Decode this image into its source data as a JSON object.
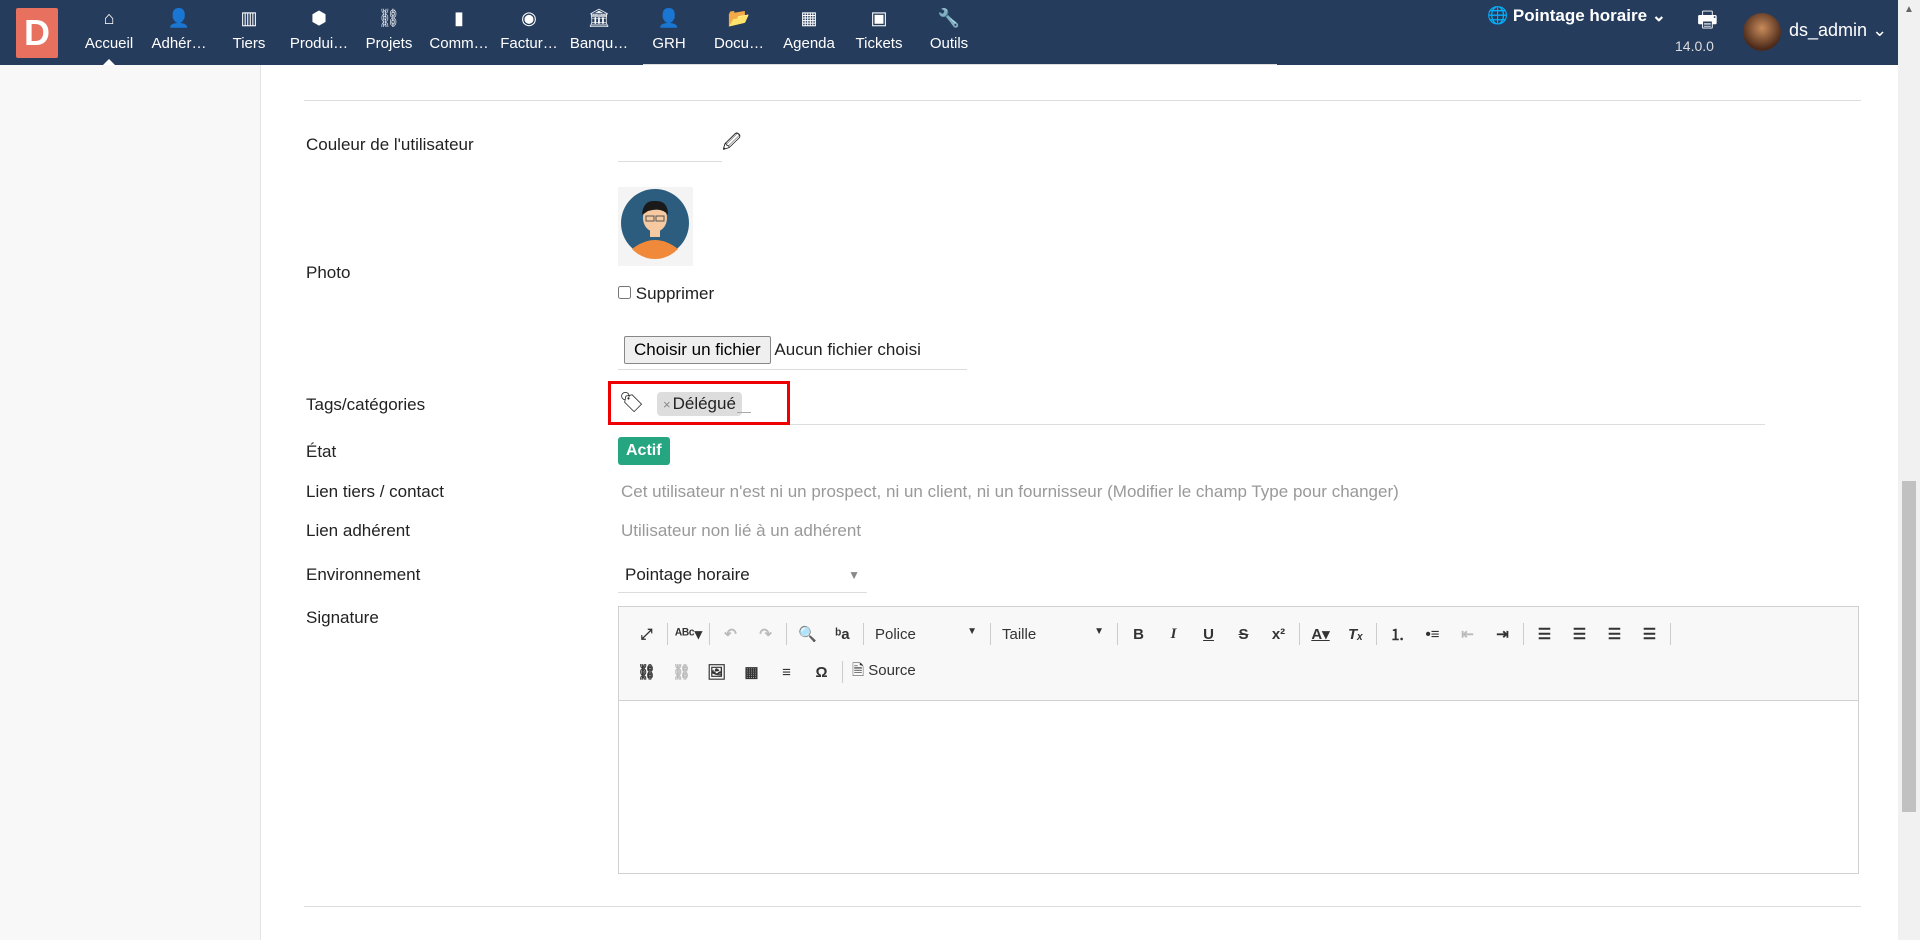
{
  "header": {
    "logo": "D",
    "nav": [
      {
        "label": "Accueil",
        "icon": "home-icon",
        "glyph": "⌂"
      },
      {
        "label": "Adhér…",
        "icon": "user-icon",
        "glyph": "👤"
      },
      {
        "label": "Tiers",
        "icon": "building-icon",
        "glyph": "▥"
      },
      {
        "label": "Produi…",
        "icon": "cube-icon",
        "glyph": "⬢"
      },
      {
        "label": "Projets",
        "icon": "sitemap-icon",
        "glyph": "⛓"
      },
      {
        "label": "Comm…",
        "icon": "briefcase-icon",
        "glyph": "▮"
      },
      {
        "label": "Factur…",
        "icon": "coins-icon",
        "glyph": "◉"
      },
      {
        "label": "Banqu…",
        "icon": "bank-icon",
        "glyph": "🏛"
      },
      {
        "label": "GRH",
        "icon": "user-tie-icon",
        "glyph": "👤"
      },
      {
        "label": "Docu…",
        "icon": "folder-icon",
        "glyph": "📂"
      },
      {
        "label": "Agenda",
        "icon": "calendar-icon",
        "glyph": "▦"
      },
      {
        "label": "Tickets",
        "icon": "ticket-icon",
        "glyph": "▣"
      },
      {
        "label": "Outils",
        "icon": "wrench-icon",
        "glyph": "🔧"
      }
    ],
    "environment": "Pointage horaire",
    "version": "14.0.0",
    "user": "ds_admin"
  },
  "form": {
    "color_label": "Couleur de l'utilisateur",
    "photo_label": "Photo",
    "delete_label": "Supprimer",
    "file_button": "Choisir un fichier",
    "file_none": "Aucun fichier choisi",
    "tags_label": "Tags/catégories",
    "tag": "Délégué",
    "state_label": "État",
    "state_value": "Actif",
    "thirdparty_label": "Lien tiers / contact",
    "thirdparty_value": "Cet utilisateur n'est ni un prospect, ni un client, ni un fournisseur (Modifier le champ Type pour changer)",
    "member_label": "Lien adhérent",
    "member_value": "Utilisateur non lié à un adhérent",
    "env_label": "Environnement",
    "env_value": "Pointage horaire",
    "signature_label": "Signature"
  },
  "editor": {
    "font": "Police",
    "size": "Taille",
    "source": "Source"
  },
  "colors": {
    "header": "#263c5c",
    "accent": "#25a580",
    "highlight": "#e00000"
  }
}
